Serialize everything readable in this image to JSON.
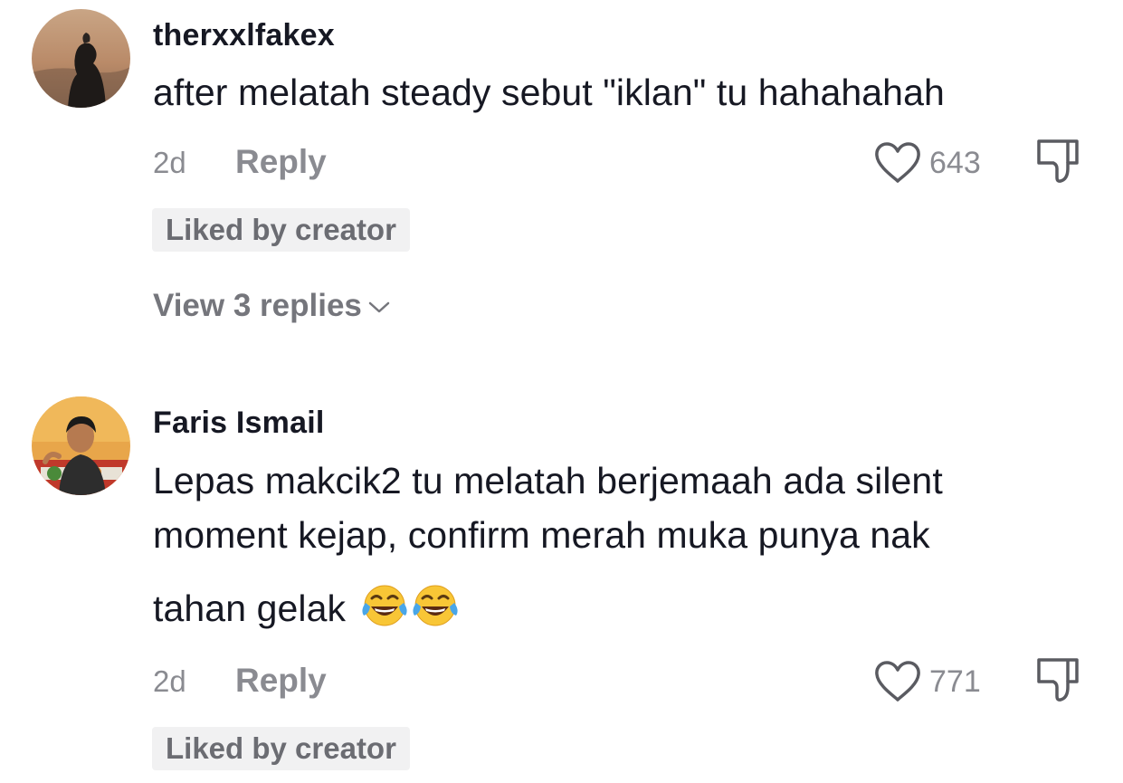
{
  "comments": [
    {
      "username": "therxxlfakex",
      "text": "after melatah steady sebut \"iklan\" tu hahahahah",
      "time": "2d",
      "reply_label": "Reply",
      "likes": "643",
      "liked_badge": "Liked by creator",
      "view_replies": "View 3 replies"
    },
    {
      "username": "Faris Ismail",
      "text_line1": "Lepas makcik2 tu melatah berjemaah ada silent",
      "text_line2": "moment kejap, confirm merah muka punya nak",
      "text_line3": "tahan gelak",
      "emoji": "face-with-tears-of-joy x2",
      "time": "2d",
      "reply_label": "Reply",
      "likes": "771",
      "liked_badge": "Liked by creator"
    }
  ],
  "colors": {
    "text_primary": "#161823",
    "text_secondary": "#8a8b91",
    "badge_bg": "#f1f1f2"
  },
  "icons": [
    "heart-outline-icon",
    "thumbs-down-icon",
    "chevron-down-icon",
    "face-with-tears-of-joy-emoji"
  ]
}
